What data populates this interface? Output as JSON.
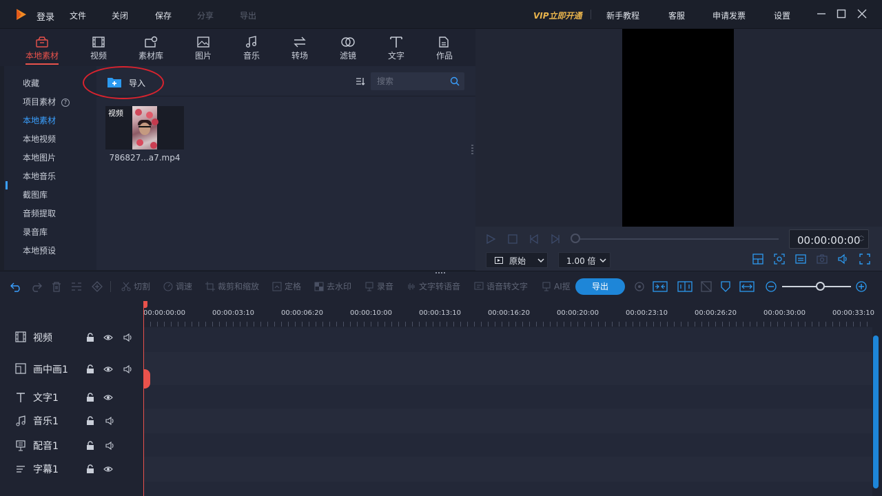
{
  "titlebar": {
    "login": "登录",
    "menu": [
      "文件",
      "关闭",
      "保存",
      "分享",
      "导出"
    ],
    "vip": "VIP立即开通",
    "links": [
      "新手教程",
      "客服",
      "申请发票",
      "设置"
    ],
    "accent": "#e9b44c"
  },
  "tabs": [
    {
      "label": "本地素材",
      "icon": "package-icon",
      "active": true
    },
    {
      "label": "视频",
      "icon": "film-icon"
    },
    {
      "label": "素材库",
      "icon": "library-icon"
    },
    {
      "label": "图片",
      "icon": "image-icon"
    },
    {
      "label": "音乐",
      "icon": "music-icon"
    },
    {
      "label": "转场",
      "icon": "transition-icon"
    },
    {
      "label": "滤镜",
      "icon": "filter-icon"
    },
    {
      "label": "文字",
      "icon": "text-icon"
    },
    {
      "label": "作品",
      "icon": "folder-icon"
    }
  ],
  "sidebar": {
    "items": [
      {
        "label": "收藏"
      },
      {
        "label": "项目素材",
        "help": "?"
      },
      {
        "label": "本地素材",
        "active": true
      },
      {
        "label": "本地视频"
      },
      {
        "label": "本地图片"
      },
      {
        "label": "本地音乐"
      },
      {
        "label": "截图库"
      },
      {
        "label": "音频提取"
      },
      {
        "label": "录音库"
      },
      {
        "label": "本地预设"
      }
    ]
  },
  "media": {
    "import_label": "导入",
    "search_placeholder": "搜索",
    "items": [
      {
        "badge": "视频",
        "name": "786827...a7.mp4"
      }
    ]
  },
  "preview": {
    "timecode": "00:00:00:00",
    "aspect": "原始",
    "speed": "1.00 倍"
  },
  "toolbar": {
    "tools": [
      "切割",
      "调速",
      "裁剪和缩放",
      "定格",
      "去水印",
      "录音",
      "文字转语音",
      "语音转文字",
      "AI抠"
    ],
    "export": "导出",
    "accent": "#1e86d8"
  },
  "timeline": {
    "ticks": [
      "00:00:00:00",
      "00:00:03:10",
      "00:00:06:20",
      "00:00:10:00",
      "00:00:13:10",
      "00:00:16:20",
      "00:00:20:00",
      "00:00:23:10",
      "00:00:26:20",
      "00:00:30:00",
      "00:00:33:10"
    ],
    "tracks": [
      {
        "label": "视频",
        "icon": "film-icon",
        "controls": [
          "lock",
          "eye",
          "volume"
        ]
      },
      {
        "label": "画中画1",
        "icon": "pip-icon",
        "controls": [
          "lock",
          "eye",
          "volume"
        ]
      },
      {
        "label": "文字1",
        "icon": "text-icon",
        "controls": [
          "lock",
          "eye"
        ]
      },
      {
        "label": "音乐1",
        "icon": "music-icon",
        "controls": [
          "lock",
          "volume"
        ]
      },
      {
        "label": "配音1",
        "icon": "mic-icon",
        "controls": [
          "lock",
          "volume"
        ]
      },
      {
        "label": "字幕1",
        "icon": "subtitle-icon",
        "controls": [
          "lock",
          "eye"
        ]
      }
    ],
    "playhead_color": "#e9524c"
  }
}
